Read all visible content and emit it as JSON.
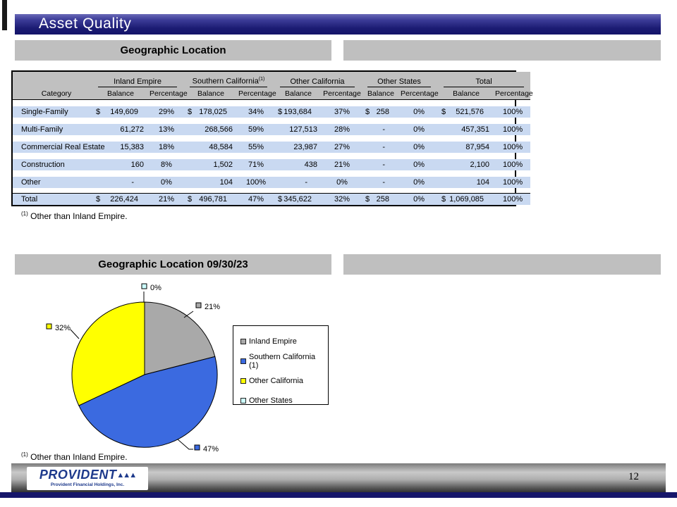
{
  "slide": {
    "title": "Asset Quality"
  },
  "bars": {
    "section1_title": "Geographic Location",
    "section2_title": "Geographic Location 09/30/23"
  },
  "table": {
    "category_header": "Category",
    "groups": [
      {
        "label": "Inland Empire",
        "sup": ""
      },
      {
        "label": "Southern California",
        "sup": "(1)"
      },
      {
        "label": "Other California",
        "sup": ""
      },
      {
        "label": "Other States",
        "sup": ""
      },
      {
        "label": "Total",
        "sup": ""
      }
    ],
    "sub_headers": [
      "Balance",
      "Percentage"
    ],
    "rows": [
      [
        "Single-Family",
        "$ 149,609",
        "29%",
        "$ 178,025",
        "34%",
        "$ 193,684",
        "37%",
        "$ 258",
        "0%",
        "$ 521,576",
        "100%"
      ],
      [
        "Multi-Family",
        "61,272",
        "13%",
        "268,566",
        "59%",
        "127,513",
        "28%",
        "-",
        "0%",
        "457,351",
        "100%"
      ],
      [
        "Commercial Real Estate",
        "15,383",
        "18%",
        "48,584",
        "55%",
        "23,987",
        "27%",
        "-",
        "0%",
        "87,954",
        "100%"
      ],
      [
        "Construction",
        "160",
        "8%",
        "1,502",
        "71%",
        "438",
        "21%",
        "-",
        "0%",
        "2,100",
        "100%"
      ],
      [
        "Other",
        "-",
        "0%",
        "104",
        "100%",
        "-",
        "0%",
        "-",
        "0%",
        "104",
        "100%"
      ]
    ],
    "total_row": [
      "Total",
      "$ 226,424",
      "21%",
      "$ 496,781",
      "47%",
      "$ 345,622",
      "32%",
      "$ 258",
      "0%",
      "$1,069,085",
      "100%"
    ]
  },
  "footnote": {
    "marker": "(1)",
    "text": "Other than Inland Empire."
  },
  "chart_data": {
    "type": "pie",
    "title": "Geographic Location 09/30/23",
    "start_angle_deg": -90,
    "direction": "clockwise",
    "legend_position": "right",
    "slices": [
      {
        "label": "Inland Empire",
        "value_pct": 21,
        "pct_label": "21%",
        "color": "#A9A9A9"
      },
      {
        "label": "Southern California (1)",
        "value_pct": 47,
        "pct_label": "47%",
        "color": "#3B6AE0"
      },
      {
        "label": "Other California",
        "value_pct": 32,
        "pct_label": "32%",
        "color": "#FFFF00"
      },
      {
        "label": "Other States",
        "value_pct": 0,
        "pct_label": "0%",
        "color": "#CCFFFF"
      }
    ]
  },
  "footer": {
    "logo_text": "PROVIDENT",
    "logo_subtext": "Provident Financial Holdings, Inc.",
    "page_number": "12"
  }
}
